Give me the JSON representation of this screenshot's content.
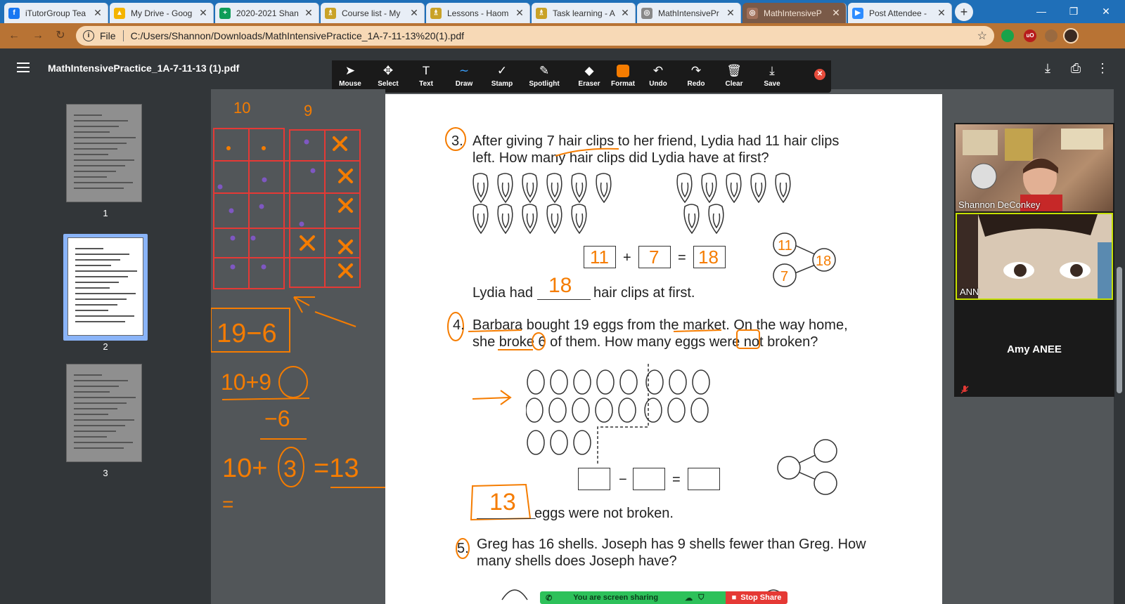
{
  "browser": {
    "tabs": [
      {
        "label": "iTutorGroup Tea",
        "icon": "facebook-icon",
        "color": "#1877f2",
        "glyph": "f"
      },
      {
        "label": "My Drive - Goog",
        "icon": "google-drive-icon",
        "color": "#f4b400",
        "glyph": "▲"
      },
      {
        "label": "2020-2021 Shan",
        "icon": "google-sheets-icon",
        "color": "#0f9d58",
        "glyph": "+"
      },
      {
        "label": "Course list - My",
        "icon": "course-icon",
        "color": "#c9a227",
        "glyph": "♗"
      },
      {
        "label": "Lessons - Haom",
        "icon": "course-icon",
        "color": "#c9a227",
        "glyph": "♗"
      },
      {
        "label": "Task learning - A",
        "icon": "course-icon",
        "color": "#c9a227",
        "glyph": "♗"
      },
      {
        "label": "MathIntensivePr",
        "icon": "globe-icon",
        "color": "#888888",
        "glyph": "◎"
      },
      {
        "label": "MathIntensiveP",
        "icon": "globe-icon",
        "color": "#a0705a",
        "glyph": "◎"
      },
      {
        "label": "Post Attendee -",
        "icon": "zoom-icon",
        "color": "#2d8cff",
        "glyph": "▶"
      }
    ],
    "active_tab": 7,
    "new_tab": "+",
    "window_buttons": {
      "minimize": "—",
      "restore": "❐",
      "close": "✕"
    },
    "address": {
      "scheme": "File",
      "url": "C:/Users/Shannon/Downloads/MathIntensivePractice_1A-7-11-13%20(1).pdf"
    }
  },
  "pdf_viewer": {
    "title": "MathIntensivePractice_1A-7-11-13 (1).pdf",
    "pages": [
      "1",
      "2",
      "3"
    ],
    "selected_page": "2"
  },
  "annotation_toolbar": {
    "tools": [
      {
        "name": "mouse",
        "label": "Mouse",
        "glyph": "➤"
      },
      {
        "name": "select",
        "label": "Select",
        "glyph": "✥"
      },
      {
        "name": "text",
        "label": "Text",
        "glyph": "T"
      },
      {
        "name": "draw",
        "label": "Draw",
        "glyph": "∼"
      },
      {
        "name": "stamp",
        "label": "Stamp",
        "glyph": "✓"
      },
      {
        "name": "spotlight",
        "label": "Spotlight",
        "glyph": "✎"
      },
      {
        "name": "eraser",
        "label": "Eraser",
        "glyph": "◆"
      },
      {
        "name": "format",
        "label": "Format",
        "glyph": ""
      },
      {
        "name": "undo",
        "label": "Undo",
        "glyph": "↶"
      },
      {
        "name": "redo",
        "label": "Redo",
        "glyph": "↷"
      },
      {
        "name": "clear",
        "label": "Clear",
        "glyph": "🗑"
      },
      {
        "name": "save",
        "label": "Save",
        "glyph": "⤓"
      }
    ],
    "active_tool": "Draw",
    "format_color": "#f57c00",
    "close": "✕"
  },
  "worksheet": {
    "q3": {
      "number": "3.",
      "line1": "After giving 7 hair clips to her friend, Lydia had 11 hair clips",
      "line2": "left. How many hair clips did Lydia have at first?",
      "answer_prefix": "Lydia had",
      "answer_suffix": "hair clips at first.",
      "answer": "18",
      "box1": "11",
      "op1": "+",
      "box2": "7",
      "eq": "=",
      "box3": "18",
      "bond_a": "11",
      "bond_b": "7",
      "bond_total": "18"
    },
    "q4": {
      "number": "4.",
      "line1": "Barbara bought 19 eggs from the market. On the way home,",
      "line2": "she broke 6 of them. How many eggs were not broken?",
      "op1": "−",
      "eq": "=",
      "answer": "13",
      "answer_suffix": "eggs were not broken."
    },
    "q5": {
      "number": "5.",
      "line1": "Greg has 16 shells. Joseph has 9 shells fewer than Greg. How",
      "line2": "many shells does Joseph have?"
    }
  },
  "whiteboard": {
    "col_label_1": "10",
    "col_label_2": "9",
    "expr1": "19−6",
    "expr2": "10+9",
    "expr3": "−6",
    "expr4_a": "10+",
    "expr4_b": "3",
    "expr4_c": "=13",
    "expr5": "=",
    "ink_color": "#f57c00",
    "grid_color": "#e53935"
  },
  "video_panel": {
    "participants": [
      {
        "name": "Shannon DeConkey"
      },
      {
        "name": "ANN"
      }
    ],
    "audio_only_name": "Amy ANEE"
  },
  "share_bar": {
    "status": "You are screen sharing",
    "stop_label": "Stop Share"
  },
  "colors": {
    "tab_strip": "#1f6fb8",
    "toolbar_theme": "#b87334",
    "active_tab": "#7a5a48",
    "share_green": "#2dc15a",
    "stop_red": "#e53935"
  }
}
